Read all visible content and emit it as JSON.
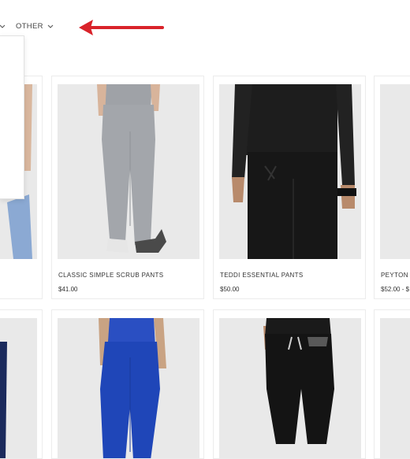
{
  "nav": {
    "other_label": "OTHER"
  },
  "products": [
    {
      "name": "",
      "price": ""
    },
    {
      "name": "CLASSIC SIMPLE SCRUB PANTS",
      "price": "$41.00"
    },
    {
      "name": "TEDDI ESSENTIAL PANTS",
      "price": "$50.00"
    },
    {
      "name": "PEYTON C",
      "price": "$52.00 - $"
    }
  ],
  "colors": {
    "arrow": "#d9232a",
    "image_bg": "#e9e9e9",
    "card_border": "#ececec",
    "gray_scrub": "#a3a6ab",
    "black_scrub": "#1b1b1b",
    "royal_blue_scrub": "#1f46b8",
    "navy_scrub": "#1b2a5c",
    "ceil_blue_scrub": "#8ba9d3"
  }
}
